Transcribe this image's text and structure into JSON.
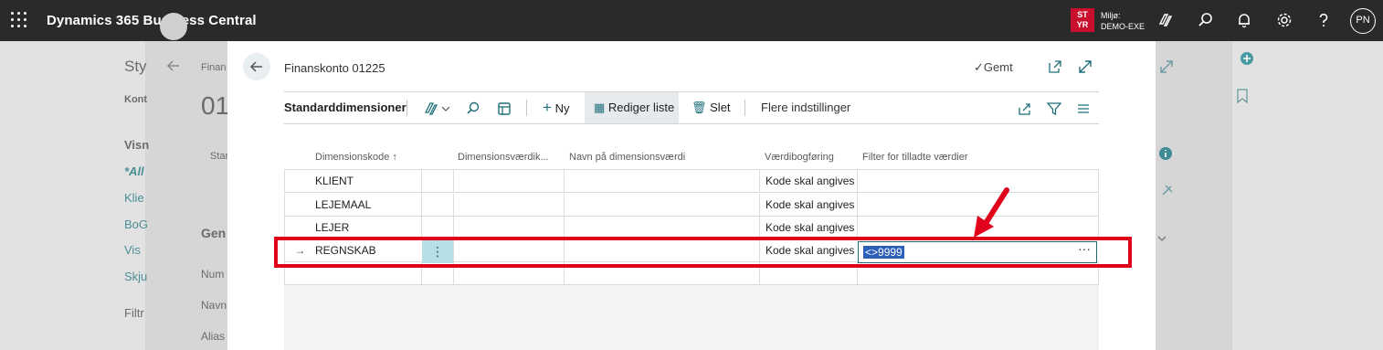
{
  "topbar": {
    "app_title": "Dynamics 365 Business Central",
    "env_badge": "ST YR",
    "env_label": "Miljø:",
    "env_value": "DEMO-EXE",
    "avatar": "PN",
    "icons": [
      "waffle-icon",
      "copilot-icon",
      "search-icon",
      "bell-icon",
      "gear-icon",
      "help-icon"
    ]
  },
  "background_page": {
    "title_fragment": "Sty",
    "breadcrumb_fragment": "Finan",
    "number_fragment": "01",
    "left_labels": [
      "Kont",
      "Visn",
      "*All",
      "Klie",
      "BoG",
      "Vis",
      "Skju",
      "Filtr"
    ],
    "mid_labels": [
      "Stan",
      "Gen",
      "Num",
      "Navn",
      "Alias"
    ]
  },
  "dialog": {
    "title": "Finanskonto 01225",
    "saved_label": "Gemt",
    "actionbar": {
      "section_title": "Standarddimensioner",
      "new_label": "Ny",
      "edit_list_label": "Rediger liste",
      "delete_label": "Slet",
      "more_options_label": "Flere indstillinger"
    },
    "grid": {
      "columns": [
        "Dimensionskode",
        "Dimensionsværdik...",
        "Navn på dimensionsværdi",
        "Værdibogføring",
        "Filter for tilladte værdier"
      ],
      "sort_indicator": "↑",
      "rows": [
        {
          "code": "KLIENT",
          "value": "",
          "name": "",
          "posting": "Kode skal angives",
          "filter": ""
        },
        {
          "code": "LEJEMAAL",
          "value": "",
          "name": "",
          "posting": "Kode skal angives",
          "filter": ""
        },
        {
          "code": "LEJER",
          "value": "",
          "name": "",
          "posting": "Kode skal angives",
          "filter": ""
        },
        {
          "code": "REGNSKAB",
          "value": "",
          "name": "",
          "posting": "Kode skal angives",
          "filter": "<>9999"
        }
      ],
      "current_row_marker": "→",
      "row_menu_glyph": "⋮",
      "lookup_glyph": "···"
    }
  },
  "colors": {
    "topbar": "#2a2a2a",
    "highlight_red": "#e0001b",
    "selection_blue": "#2c5fb8",
    "teal": "#b6dfe6"
  }
}
